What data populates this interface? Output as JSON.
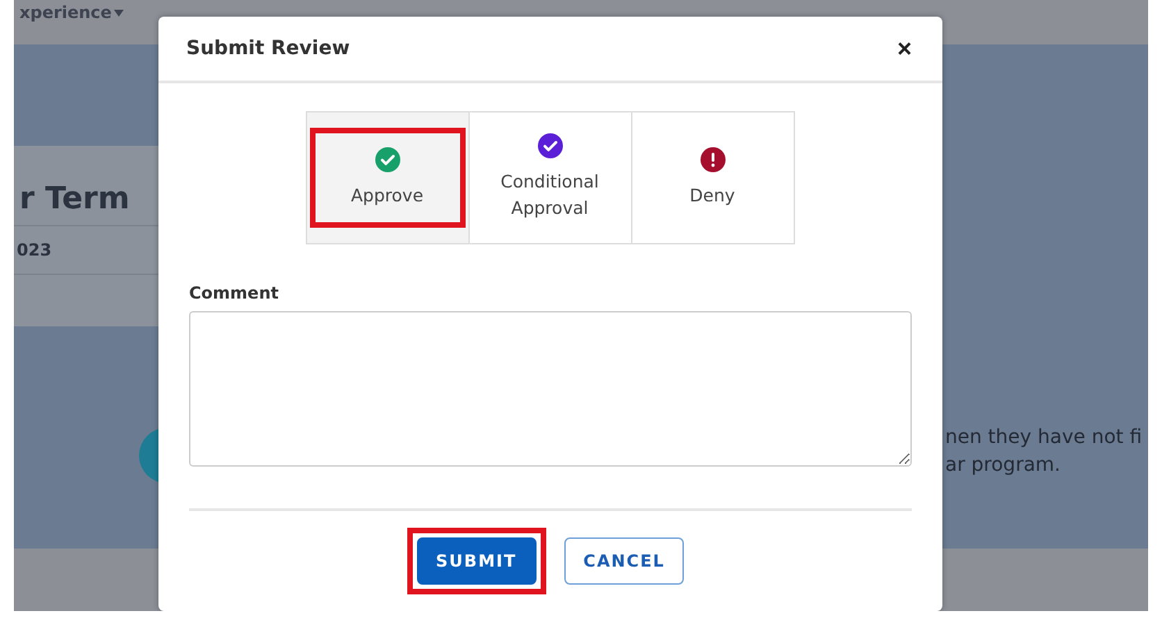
{
  "background": {
    "nav_text": "xperience",
    "heading": "r Term",
    "date": "023",
    "notice_lines": [
      "nen they have not fi",
      "ar program."
    ]
  },
  "dialog": {
    "title": "Submit Review",
    "close": "×",
    "options": [
      {
        "label": "Approve",
        "kind": "approve",
        "selected": true,
        "highlighted": true
      },
      {
        "label": "Conditional Approval",
        "kind": "conditional",
        "selected": false,
        "highlighted": false
      },
      {
        "label": "Deny",
        "kind": "deny",
        "selected": false,
        "highlighted": false
      }
    ],
    "comment": {
      "label": "Comment"
    },
    "buttons": [
      {
        "label": "SUBMIT",
        "kind": "primary",
        "highlighted": true
      },
      {
        "label": "CANCEL",
        "kind": "secondary",
        "highlighted": false
      }
    ]
  }
}
